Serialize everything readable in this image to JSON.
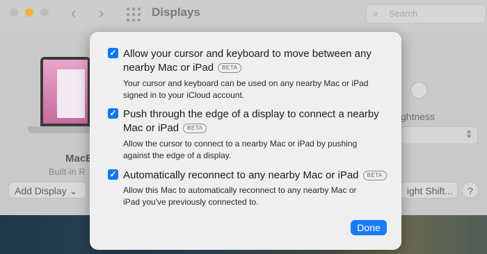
{
  "window": {
    "title": "Displays",
    "search_placeholder": "Search",
    "display_name": "MacB",
    "display_subtitle": "Built-in R",
    "add_display_label": "Add Display",
    "brightness_label": "ghtness",
    "night_shift_label": "ight Shift...",
    "help_label": "?"
  },
  "dialog": {
    "options": [
      {
        "checked": true,
        "title_line1": "Allow your cursor and keyboard to move between any",
        "title_line2": "nearby Mac or iPad",
        "badge": "BETA",
        "description_line1": "Your cursor and keyboard can be used on any nearby Mac or iPad",
        "description_line2": "signed in to your iCloud account."
      },
      {
        "checked": true,
        "title_line1": "Push through the edge of a display to connect a nearby",
        "title_line2": "Mac or iPad",
        "badge": "BETA",
        "description_line1": "Allow the cursor to connect to a nearby Mac or iPad by pushing",
        "description_line2": "against the edge of a display."
      },
      {
        "checked": true,
        "title_line1": "Automatically reconnect to any nearby Mac or iPad",
        "badge": "BETA",
        "description_line1": "Allow this Mac to automatically reconnect to any nearby Mac or",
        "description_line2": "iPad you've previously connected to."
      }
    ],
    "done_label": "Done"
  }
}
